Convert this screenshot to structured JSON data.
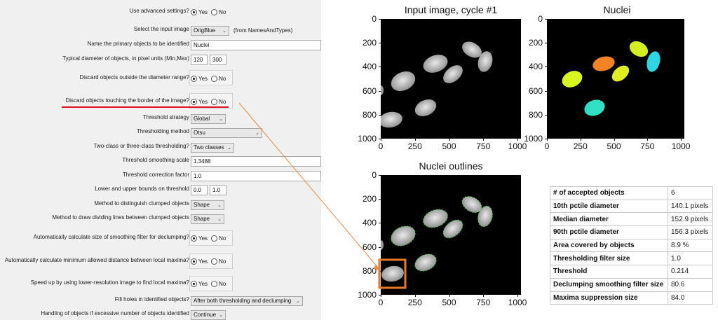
{
  "settings": {
    "advanced": {
      "label": "Use advanced settings?",
      "yes": "Yes",
      "no": "No"
    },
    "input_image": {
      "label": "Select the input image",
      "value": "OrigBlue",
      "note": "(from NamesAndTypes)"
    },
    "object_name": {
      "label": "Name the primary objects to be identified",
      "value": "Nuclei"
    },
    "diameter": {
      "label": "Typical diameter of objects, in pixel units (Min,Max)",
      "min": "120",
      "max": "300"
    },
    "discard_outside": {
      "label": "Discard objects outside the diameter range?",
      "yes": "Yes",
      "no": "No"
    },
    "discard_border": {
      "label": "Discard objects touching the border of the image?",
      "yes": "Yes",
      "no": "No"
    },
    "threshold_strategy": {
      "label": "Threshold strategy",
      "value": "Global"
    },
    "threshold_method": {
      "label": "Thresholding method",
      "value": "Otsu"
    },
    "two_three_class": {
      "label": "Two-class or three-class thresholding?",
      "value": "Two classes"
    },
    "smoothing_scale": {
      "label": "Threshold smoothing scale",
      "value": "1.3488"
    },
    "correction_factor": {
      "label": "Threshold correction factor",
      "value": "1.0"
    },
    "bounds": {
      "label": "Lower and upper bounds on threshold",
      "lower": "0.0",
      "upper": "1.0"
    },
    "declump_method": {
      "label": "Method to distinguish clumped objects",
      "value": "Shape"
    },
    "dividing_method": {
      "label": "Method to draw dividing lines between clumped objects",
      "value": "Shape"
    },
    "auto_smoothing": {
      "label": "Automatically calculate size of smoothing filter for declumping?",
      "yes": "Yes",
      "no": "No"
    },
    "auto_maxima": {
      "label": "Automatically calculate minimum allowed distance between local maxima?",
      "yes": "Yes",
      "no": "No"
    },
    "low_res": {
      "label": "Speed up by using lower-resolution image to find local maxima?",
      "yes": "Yes",
      "no": "No"
    },
    "fill_holes": {
      "label": "Fill holes in identified objects?",
      "value": "After both thresholding and declumping"
    },
    "excessive": {
      "label": "Handling of objects if excessive number of objects identified",
      "value": "Continue"
    }
  },
  "plots": {
    "input": {
      "title": "Input image, cycle #1"
    },
    "nuclei": {
      "title": "Nuclei"
    },
    "outlines": {
      "title": "Nuclei outlines"
    },
    "ticks": [
      "0",
      "200",
      "400",
      "600",
      "800",
      "1000"
    ],
    "xticks": [
      "0",
      "250",
      "500",
      "750",
      "1000"
    ]
  },
  "stats": [
    {
      "k": "# of accepted objects",
      "v": "6"
    },
    {
      "k": "10th pctile diameter",
      "v": "140.1 pixels"
    },
    {
      "k": "Median diameter",
      "v": "152.9 pixels"
    },
    {
      "k": "90th pctile diameter",
      "v": "156.3 pixels"
    },
    {
      "k": "Area covered by objects",
      "v": "8.9 %"
    },
    {
      "k": "Thresholding filter size",
      "v": "1.0"
    },
    {
      "k": "Threshold",
      "v": "0.214"
    },
    {
      "k": "Declumping smoothing filter size",
      "v": "80.6"
    },
    {
      "k": "Maxima suppression size",
      "v": "84.0"
    }
  ],
  "colors": {
    "highlight_line": "#e0141e",
    "arrow": "#ee8a3c",
    "box": "#e87a2a",
    "outline": "#3cc83c"
  }
}
